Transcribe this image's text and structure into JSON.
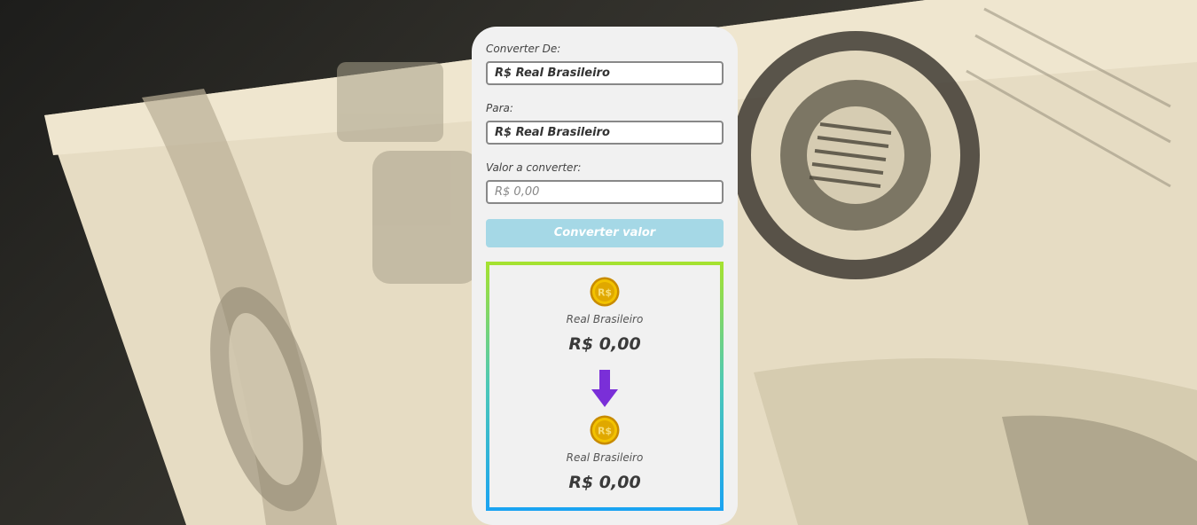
{
  "form": {
    "from_label": "Converter De:",
    "from_value": "R$ Real Brasileiro",
    "to_label": "Para:",
    "to_value": "R$ Real Brasileiro",
    "amount_label": "Valor a converter:",
    "amount_placeholder": "R$ 0,00",
    "convert_button": "Converter valor"
  },
  "result": {
    "from": {
      "icon": "coin-icon",
      "name": "Real Brasileiro",
      "value": "R$ 0,00"
    },
    "arrow_icon": "arrow-down-icon",
    "to": {
      "icon": "coin-icon",
      "name": "Real Brasileiro",
      "value": "R$ 0,00"
    }
  },
  "colors": {
    "card_bg": "#f1f1f1",
    "button_bg": "#a5d8e6",
    "border_gradient_top": "#a6e22e",
    "border_gradient_bottom": "#1aa3f2",
    "arrow": "#7a2fd8",
    "coin": "#e0a800"
  }
}
